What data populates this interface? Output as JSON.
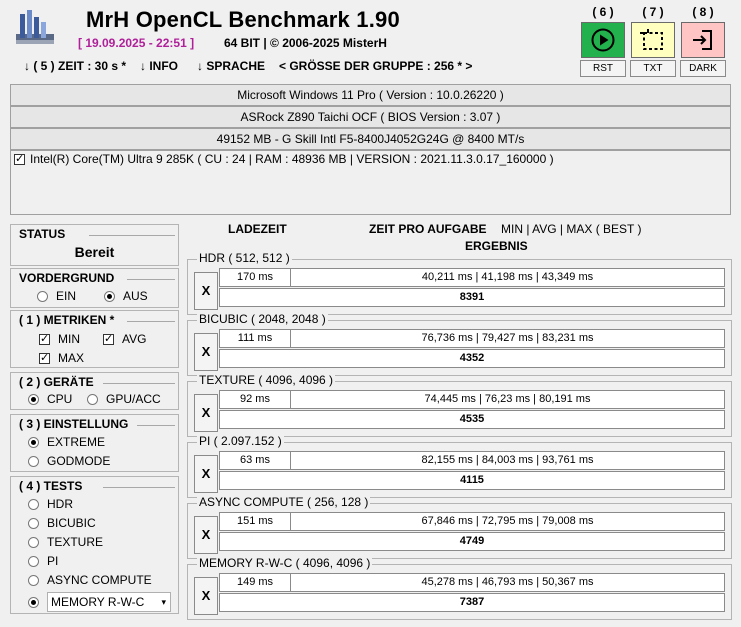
{
  "header": {
    "title": "MrH OpenCL Benchmark 1.90",
    "date": "[ 19.09.2025 - 22:51 ]",
    "bits": "64 BIT | ©  2006-2025 MisterH",
    "menu": {
      "zeit": "↓ ( 5 ) ZEIT : 30 s *",
      "info": "↓ INFO",
      "sprache": "↓ SPRACHE",
      "gruppe": "< GRÖSSE DER GRUPPE : 256 * >"
    },
    "buttons": [
      {
        "num": "( 6 )",
        "label": "RST",
        "color": "#22b14c",
        "icon": "play-icon"
      },
      {
        "num": "( 7 )",
        "label": "TXT",
        "color": "#ffffbf",
        "icon": "select-icon"
      },
      {
        "num": "( 8 )",
        "label": "DARK",
        "color": "#ffc4c4",
        "icon": "exit-icon"
      }
    ]
  },
  "system": {
    "os": "Microsoft Windows 11 Pro ( Version : 10.0.26220 )",
    "board": "ASRock Z890 Taichi OCF ( BIOS Version : 3.07 )",
    "memory": "49152 MB - G Skill Intl F5-8400J4052G24G     @ 8400 MT/s",
    "cpu": "Intel(R) Core(TM) Ultra 9 285K ( CU : 24 | RAM : 48936 MB | VERSION : 2021.11.3.0.17_160000 )",
    "cpu_checked": true
  },
  "status": {
    "title": "STATUS",
    "value": "Bereit"
  },
  "vordergrund": {
    "title": "VORDERGRUND",
    "options": [
      "EIN",
      "AUS"
    ],
    "selected": 1
  },
  "metriken": {
    "title": "( 1 ) METRIKEN *",
    "min": "MIN",
    "avg": "AVG",
    "max": "MAX"
  },
  "geraete": {
    "title": "( 2 ) GERÄTE",
    "options": [
      "CPU",
      "GPU/ACC"
    ],
    "selected": 0
  },
  "einstellung": {
    "title": "( 3 ) EINSTELLUNG",
    "options": [
      "EXTREME",
      "GODMODE"
    ],
    "selected": 0
  },
  "tests": {
    "title": "( 4 ) TESTS",
    "options": [
      "HDR",
      "BICUBIC",
      "TEXTURE",
      "PI",
      "ASYNC COMPUTE",
      "MEMORY R-W-C"
    ],
    "selected": 5
  },
  "columns": {
    "ladezeit": "LADEZEIT",
    "zeit": "ZEIT PRO AUFGABE",
    "metrics": "MIN | AVG | MAX ( BEST )",
    "ergebnis": "ERGEBNIS"
  },
  "results": [
    {
      "name": "HDR ( 512, 512 )",
      "load": "170 ms",
      "times": "40,211 ms | 41,198 ms | 43,349 ms",
      "score": "8391"
    },
    {
      "name": "BICUBIC ( 2048, 2048 )",
      "load": "111 ms",
      "times": "76,736 ms | 79,427 ms | 83,231 ms",
      "score": "4352"
    },
    {
      "name": "TEXTURE ( 4096, 4096 )",
      "load": "92 ms",
      "times": "74,445 ms | 76,23 ms | 80,191 ms",
      "score": "4535"
    },
    {
      "name": "PI ( 2.097.152 )",
      "load": "63 ms",
      "times": "82,155 ms | 84,003 ms | 93,761 ms",
      "score": "4115"
    },
    {
      "name": "ASYNC COMPUTE ( 256, 128 )",
      "load": "151 ms",
      "times": "67,846 ms | 72,795 ms | 79,008 ms",
      "score": "4749"
    },
    {
      "name": "MEMORY R-W-C ( 4096, 4096 )",
      "load": "149 ms",
      "times": "45,278 ms | 46,793 ms | 50,367 ms",
      "score": "7387"
    }
  ],
  "x_label": "X"
}
